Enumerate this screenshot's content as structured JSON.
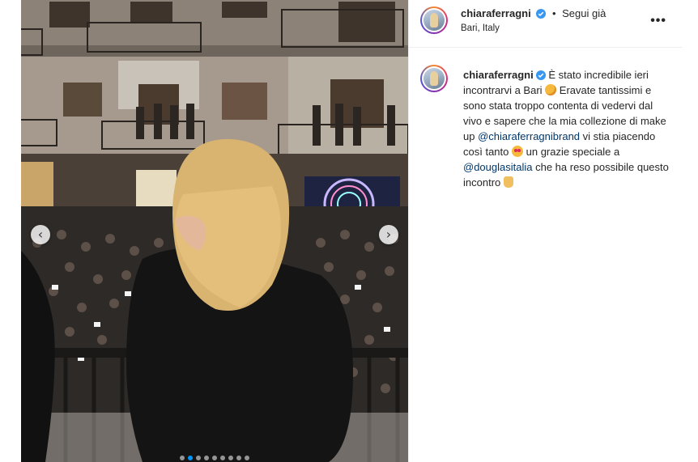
{
  "post": {
    "username": "chiaraferragni",
    "separator": "•",
    "follow_label": "Segui già",
    "location": "Bari, Italy",
    "more_label": "•••",
    "caption": {
      "part1": "È stato incredibile ieri incontrarvi a Bari",
      "part2": "Eravate tantissimi e sono stata troppo contenta di vedervi dal vivo e sapere che la mia collezione di make up",
      "mention1": "@chiaraferragnibrand",
      "part3": "vi stia piacendo così tanto",
      "part4": "un grazie speciale a",
      "mention2": "@douglasitalia",
      "part5": "che ha reso possibile questo incontro"
    }
  },
  "carousel": {
    "prev_icon": "‹",
    "next_icon": "›",
    "slide_count": 9,
    "active_index": 1
  },
  "colors": {
    "verified": "#3897f0",
    "mention": "#00376b",
    "active_dot": "#0095f6"
  }
}
